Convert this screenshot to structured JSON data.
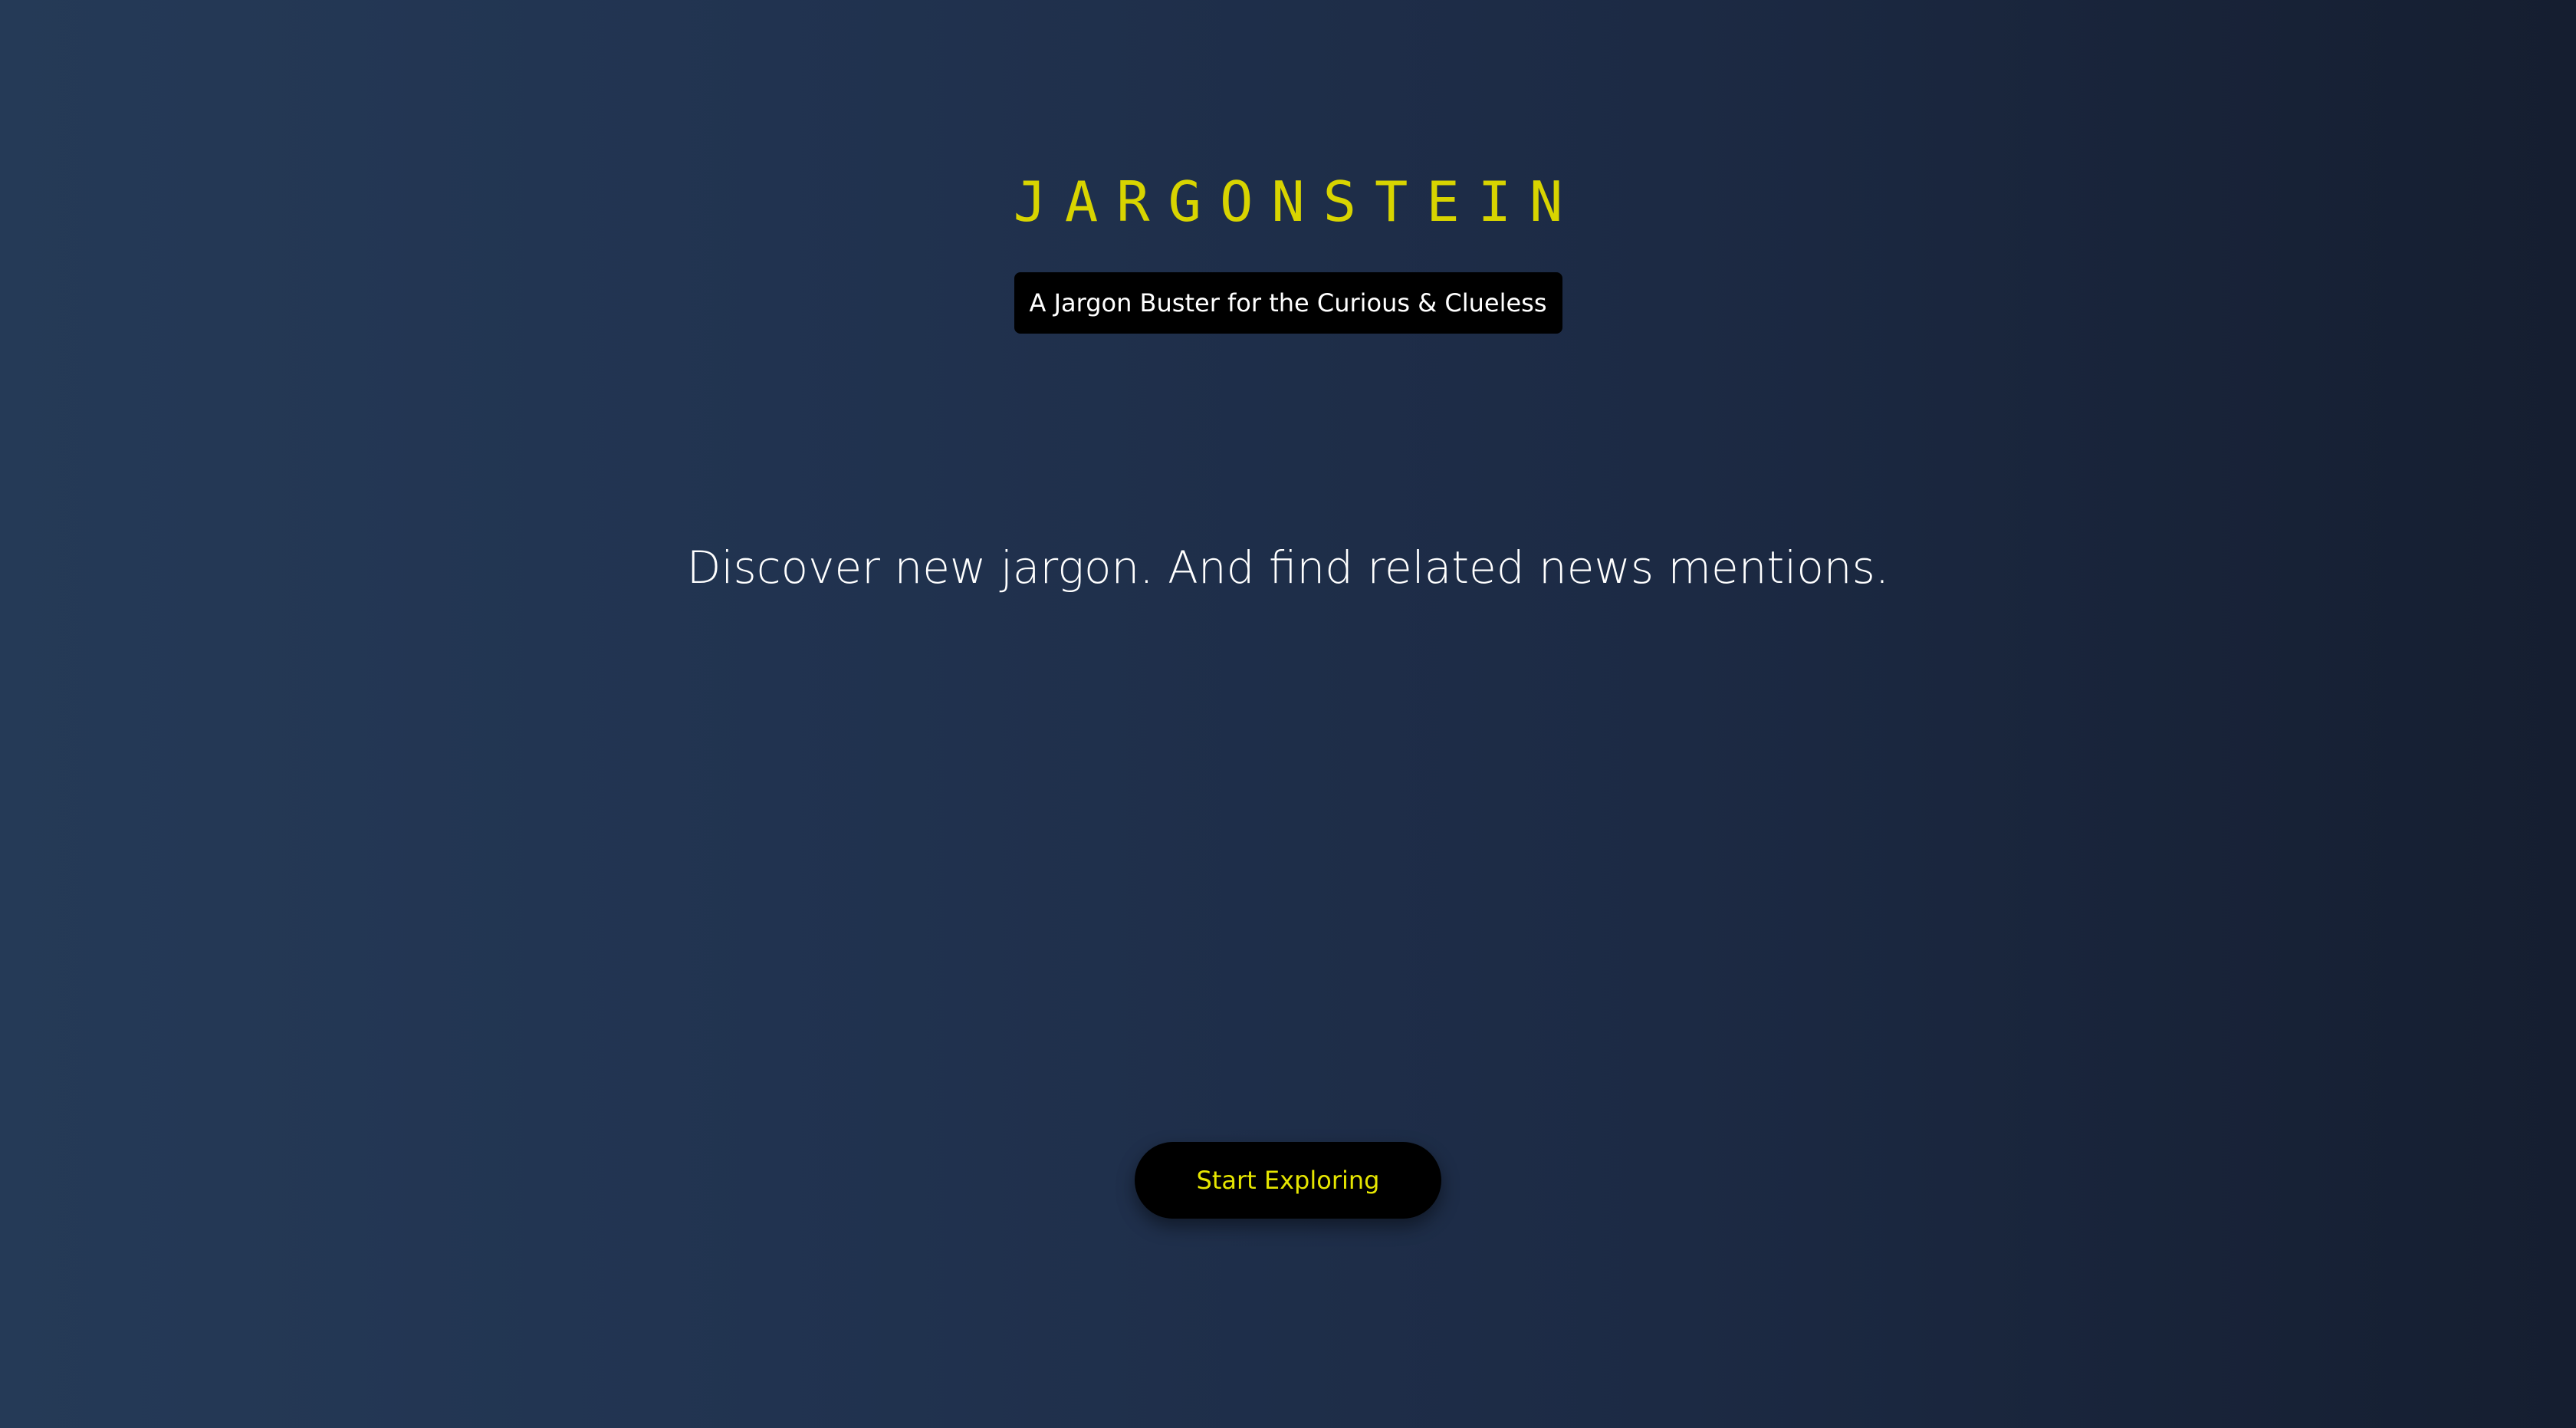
{
  "brand": {
    "logo_text": "JARGONSTEIN",
    "tagline": "A Jargon Buster for the Curious & Clueless"
  },
  "hero": {
    "headline": "Discover new jargon. And find related news mentions."
  },
  "cta": {
    "label": "Start Exploring"
  },
  "colors": {
    "accent": "#d8d400",
    "background_start": "#253a57",
    "background_end": "#151e30",
    "button_bg": "#000000",
    "text": "#ffffff"
  }
}
